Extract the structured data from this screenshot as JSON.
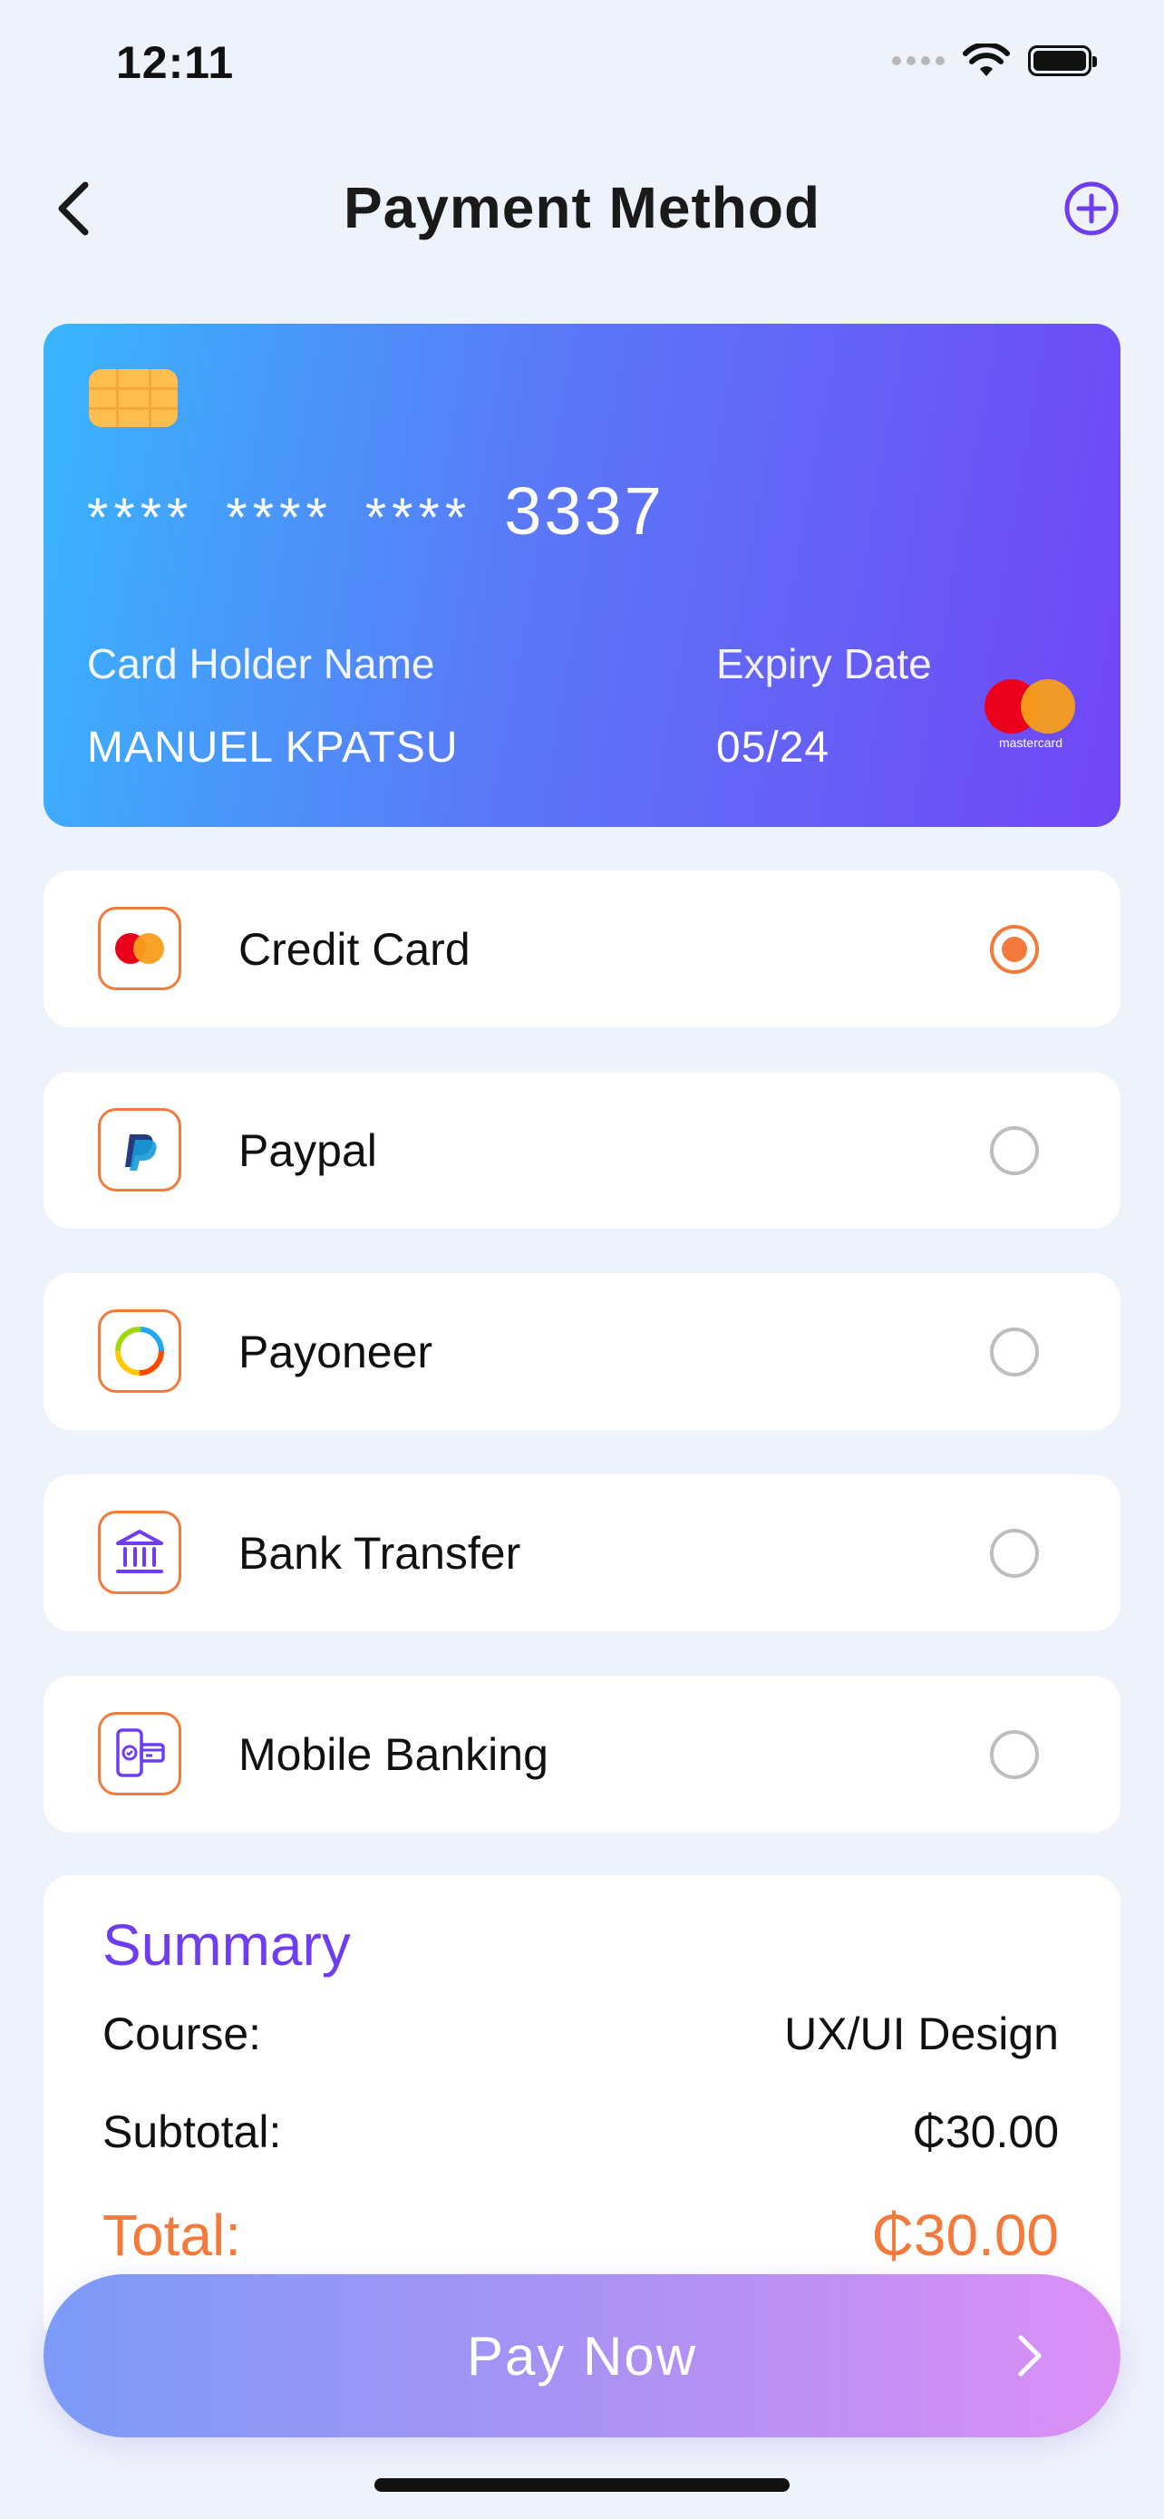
{
  "status_bar": {
    "time": "12:11"
  },
  "header": {
    "title": "Payment Method",
    "back_icon": "chevron-left-icon",
    "add_icon": "plus-circle-icon",
    "accent_color": "#6e3df2"
  },
  "card": {
    "mask_groups": [
      "****",
      "****",
      "****"
    ],
    "last4": "3337",
    "holder_label": "Card Holder Name",
    "holder_name": "MANUEL KPATSU",
    "expiry_label": "Expiry Date",
    "expiry": "05/24",
    "brand": "mastercard"
  },
  "methods": [
    {
      "label": "Credit Card",
      "icon": "mastercard-icon",
      "selected": true
    },
    {
      "label": "Paypal",
      "icon": "paypal-icon",
      "selected": false
    },
    {
      "label": "Payoneer",
      "icon": "payoneer-icon",
      "selected": false
    },
    {
      "label": "Bank Transfer",
      "icon": "bank-icon",
      "selected": false
    },
    {
      "label": "Mobile Banking",
      "icon": "mobile-banking-icon",
      "selected": false
    }
  ],
  "summary": {
    "title": "Summary",
    "course_label": "Course:",
    "course_value": "UX/UI Design",
    "subtotal_label": "Subtotal:",
    "subtotal_value": "₵30.00",
    "total_label": "Total:",
    "total_value": "₵30.00",
    "total_color": "#f47a3c"
  },
  "pay_button": {
    "label": "Pay Now",
    "icon": "chevron-right-icon"
  }
}
